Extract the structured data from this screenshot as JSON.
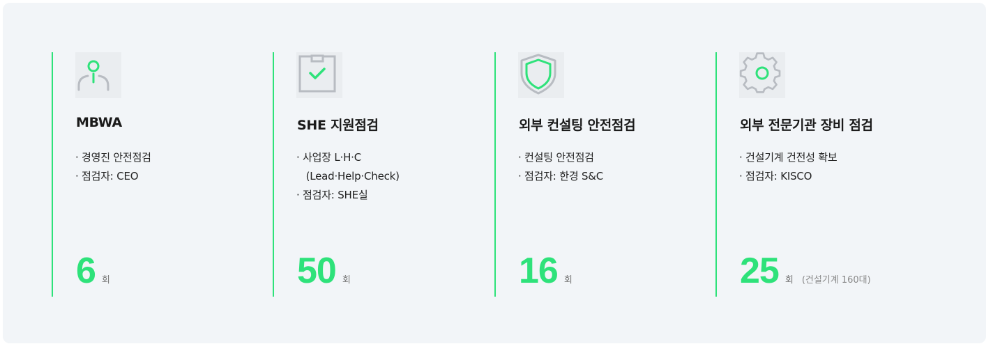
{
  "colors": {
    "accent": "#2ee27a",
    "panel_bg": "#f2f5f8",
    "icon_gray": "#b8bcc2"
  },
  "cards": [
    {
      "icon": "person-icon",
      "title": "MBWA",
      "bullets": [
        "경영진 안전점검",
        "점검자: CEO"
      ],
      "stat_value": "6",
      "stat_unit": "회",
      "stat_note": ""
    },
    {
      "icon": "checked-box-icon",
      "title": "SHE 지원점검",
      "bullets": [
        "사업장 L·H·C",
        " (Lead·Help·Check)",
        "점검자: SHE실"
      ],
      "stat_value": "50",
      "stat_unit": "회",
      "stat_note": ""
    },
    {
      "icon": "shield-icon",
      "title": "외부 컨설팅 안전점검",
      "bullets": [
        "컨설팅 안전점검",
        "점검자: 한경 S&C"
      ],
      "stat_value": "16",
      "stat_unit": "회",
      "stat_note": ""
    },
    {
      "icon": "gear-icon",
      "title": "외부 전문기관 장비 점검",
      "bullets": [
        "건설기계 건전성 확보",
        "점검자: KISCO"
      ],
      "stat_value": "25",
      "stat_unit": "회",
      "stat_note": "(건설기계 160대)"
    }
  ]
}
